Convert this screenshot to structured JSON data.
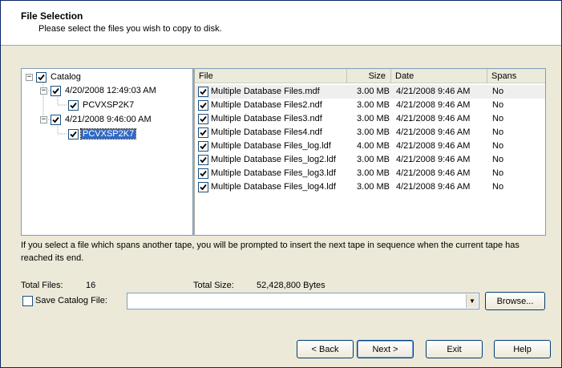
{
  "header": {
    "title": "File Selection",
    "subtitle": "Please select the files you wish to copy to disk."
  },
  "tree": {
    "root": {
      "label": "Catalog",
      "expander": "−",
      "checked": true
    },
    "nodes": [
      {
        "label": "4/20/2008 12:49:03 AM",
        "expander": "−",
        "checked": true
      },
      {
        "label": "PCVXSP2K7",
        "checked": true
      },
      {
        "label": "4/21/2008 9:46:00 AM",
        "expander": "−",
        "checked": true
      },
      {
        "label": "PCVXSP2K7",
        "checked": true,
        "selected": true
      }
    ]
  },
  "list": {
    "columns": {
      "file": "File",
      "size": "Size",
      "date": "Date",
      "spans": "Spans"
    },
    "rows": [
      {
        "file": "Multiple Database Files.mdf",
        "size": "3.00 MB",
        "date": "4/21/2008 9:46 AM",
        "spans": "No"
      },
      {
        "file": "Multiple Database Files2.ndf",
        "size": "3.00 MB",
        "date": "4/21/2008 9:46 AM",
        "spans": "No"
      },
      {
        "file": "Multiple Database Files3.ndf",
        "size": "3.00 MB",
        "date": "4/21/2008 9:46 AM",
        "spans": "No"
      },
      {
        "file": "Multiple Database Files4.ndf",
        "size": "3.00 MB",
        "date": "4/21/2008 9:46 AM",
        "spans": "No"
      },
      {
        "file": "Multiple Database Files_log.ldf",
        "size": "4.00 MB",
        "date": "4/21/2008 9:46 AM",
        "spans": "No"
      },
      {
        "file": "Multiple Database Files_log2.ldf",
        "size": "3.00 MB",
        "date": "4/21/2008 9:46 AM",
        "spans": "No"
      },
      {
        "file": "Multiple Database Files_log3.ldf",
        "size": "3.00 MB",
        "date": "4/21/2008 9:46 AM",
        "spans": "No"
      },
      {
        "file": "Multiple Database Files_log4.ldf",
        "size": "3.00 MB",
        "date": "4/21/2008 9:46 AM",
        "spans": "No"
      }
    ]
  },
  "info": {
    "text": "If you select a file which spans another tape, you will be prompted to insert the next tape in sequence when the current tape has reached its end."
  },
  "stats": {
    "total_files_label": "Total Files:",
    "total_files_value": "16",
    "total_size_label": "Total Size:",
    "total_size_value": "52,428,800 Bytes"
  },
  "save_catalog": {
    "label": "Save Catalog File:",
    "checked": false,
    "value": ""
  },
  "buttons": {
    "browse": "Browse...",
    "back": "< Back",
    "next": "Next >",
    "exit": "Exit",
    "help": "Help"
  },
  "colors": {
    "selection": "#316ac5",
    "window_bg": "#ece9d8",
    "border": "#7f9db9"
  }
}
